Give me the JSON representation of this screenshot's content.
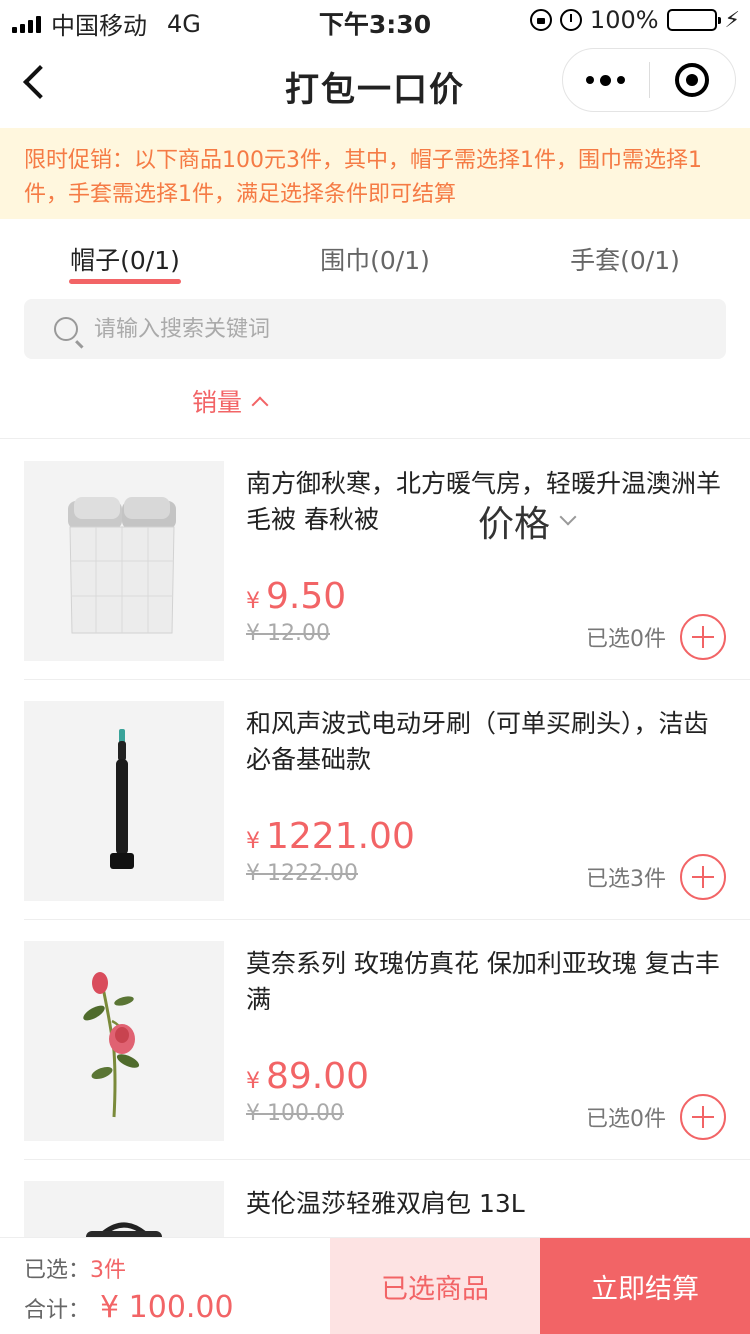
{
  "status_bar": {
    "carrier": "中国移动",
    "network": "4G",
    "time": "下午3:30",
    "battery": "100%"
  },
  "nav": {
    "title": "打包一口价"
  },
  "promo": {
    "text": "限时促销：以下商品100元3件，其中，帽子需选择1件，围巾需选择1件，手套需选择1件，满足选择条件即可结算"
  },
  "tabs": [
    {
      "label": "帽子(0/1)"
    },
    {
      "label": "围巾(0/1)"
    },
    {
      "label": "手套(0/1)"
    }
  ],
  "search": {
    "placeholder": "请输入搜索关键词"
  },
  "sort": {
    "sales": "销量",
    "price": "价格"
  },
  "products": [
    {
      "title": "南方御秋寒，北方暖气房，轻暖升温澳洲羊毛被 春秋被",
      "currency": "¥",
      "price": "9.50",
      "original": "¥ 12.00",
      "selected": "已选0件"
    },
    {
      "title": "和风声波式电动牙刷（可单买刷头），洁齿必备基础款",
      "currency": "¥",
      "price": "1221.00",
      "original": "¥ 1222.00",
      "selected": "已选3件"
    },
    {
      "title": "莫奈系列 玫瑰仿真花 保加利亚玫瑰 复古丰满",
      "currency": "¥",
      "price": "89.00",
      "original": "¥ 100.00",
      "selected": "已选0件"
    },
    {
      "title": "英伦温莎轻雅双肩包 13L"
    }
  ],
  "bottom": {
    "selected_label": "已选：",
    "selected_count": "3件",
    "total_label": "合计：",
    "total_value": "¥ 100.00",
    "selected_button": "已选商品",
    "checkout_button": "立即结算"
  },
  "colors": {
    "accent": "#f26466",
    "promo_bg": "#fff7de",
    "promo_text": "#f57b45"
  }
}
